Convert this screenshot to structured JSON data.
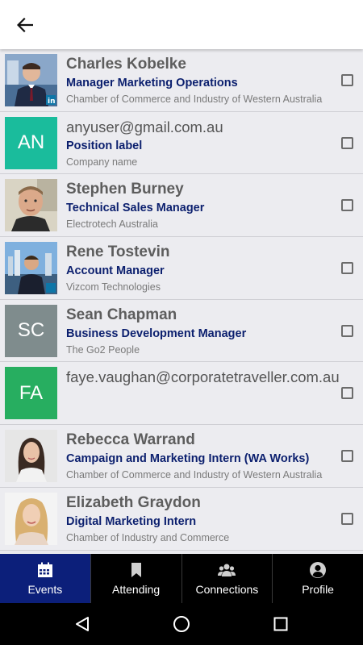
{
  "header": {
    "back_icon": "arrow-left-icon"
  },
  "attendees": [
    {
      "name": "Charles Kobelke",
      "position": "Manager Marketing Operations",
      "company": "Chamber of Commerce and Industry of Western Australia",
      "avatar": {
        "type": "photo",
        "icon": "person-photo"
      }
    },
    {
      "name": "anyuser@gmail.com.au",
      "position": "Position label",
      "company": "Company name",
      "avatar": {
        "type": "initials",
        "initials": "AN",
        "color": "#1abc9c"
      }
    },
    {
      "name": "Stephen Burney",
      "position": "Technical Sales Manager",
      "company": "Electrotech Australia",
      "avatar": {
        "type": "photo",
        "icon": "person-photo"
      }
    },
    {
      "name": "Rene Tostevin",
      "position": "Account Manager",
      "company": "Vizcom Technologies",
      "avatar": {
        "type": "photo",
        "icon": "person-photo"
      }
    },
    {
      "name": "Sean Chapman",
      "position": "Business Development Manager",
      "company": "The Go2 People",
      "avatar": {
        "type": "initials",
        "initials": "SC",
        "color": "#7f8c8d"
      }
    },
    {
      "name": "faye.vaughan@corporatetraveller.com.au",
      "position": "",
      "company": "",
      "avatar": {
        "type": "initials",
        "initials": "FA",
        "color": "#27ae60"
      }
    },
    {
      "name": "Rebecca Warrand",
      "position": "Campaign and Marketing Intern (WA Works)",
      "company": "Chamber of Commerce and Industry of Western Australia",
      "avatar": {
        "type": "photo",
        "icon": "person-photo"
      }
    },
    {
      "name": "Elizabeth Graydon",
      "position": "Digital Marketing Intern",
      "company": "Chamber of Industry and Commerce",
      "avatar": {
        "type": "photo",
        "icon": "person-photo"
      }
    }
  ],
  "tabs": [
    {
      "label": "Events",
      "icon": "calendar-icon",
      "active": true
    },
    {
      "label": "Attending",
      "icon": "bookmark-icon",
      "active": false
    },
    {
      "label": "Connections",
      "icon": "group-icon",
      "active": false
    },
    {
      "label": "Profile",
      "icon": "user-circle-icon",
      "active": false
    }
  ],
  "colors": {
    "accent": "#0c1f7a",
    "position_text": "#0b1f6e",
    "tabbar_bg": "#000000"
  }
}
